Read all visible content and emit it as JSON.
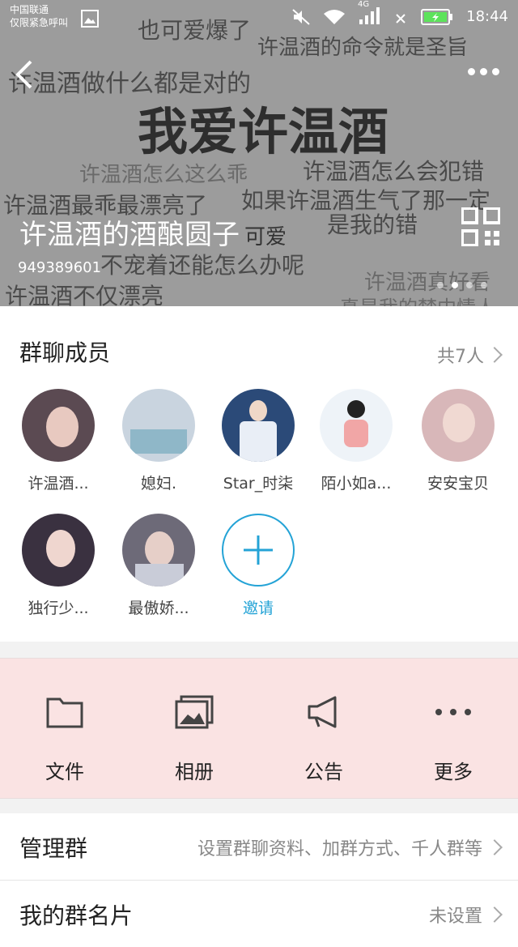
{
  "status_bar": {
    "carrier_line1": "中国联通",
    "carrier_line2": "仅限紧急呼叫",
    "network": "4G",
    "time": "18:44"
  },
  "banner": {
    "background_texts": [
      "也可爱爆了",
      "许温酒的命令就是圣旨",
      "许温酒做什么都是对的",
      "我爱许温酒",
      "许温酒怎么这么乖",
      "许温酒怎么会犯错",
      "许温酒最乖最漂亮了",
      "如果许温酒生气了那一定",
      "是我的错",
      "不宠着还能怎么办呢",
      "许温酒真好看",
      "许温酒不仅漂亮",
      "真是我的梦中情人"
    ],
    "group_name": "许温酒的酒酿圆子",
    "group_name_suffix": "可爱",
    "group_id": "949389601"
  },
  "members": {
    "title": "群聊成员",
    "count_label": "共7人",
    "items": [
      {
        "name": "许温酒...",
        "avatar_color": "#5b4a52"
      },
      {
        "name": "媳妇.",
        "avatar_color": "#c9d4df"
      },
      {
        "name": "Star_时柒",
        "avatar_color": "#2b4a78"
      },
      {
        "name": "陌小如a...",
        "avatar_color": "#eef3f8"
      },
      {
        "name": "安安宝贝",
        "avatar_color": "#d8b7b9"
      },
      {
        "name": "独行少...",
        "avatar_color": "#3a3140"
      },
      {
        "name": "最傲娇...",
        "avatar_color": "#6d6a78"
      }
    ],
    "invite_label": "邀请"
  },
  "actions": [
    {
      "label": "文件",
      "icon": "folder-icon"
    },
    {
      "label": "相册",
      "icon": "album-icon"
    },
    {
      "label": "公告",
      "icon": "megaphone-icon"
    },
    {
      "label": "更多",
      "icon": "more-icon"
    }
  ],
  "settings": {
    "manage": {
      "label": "管理群",
      "value": "设置群聊资料、加群方式、千人群等"
    },
    "my_card": {
      "label": "我的群名片",
      "value": "未设置"
    }
  },
  "colors": {
    "accent": "#24a3d6",
    "actions_bg": "#fae3e3",
    "banner_bg": "#9c9c9c"
  }
}
